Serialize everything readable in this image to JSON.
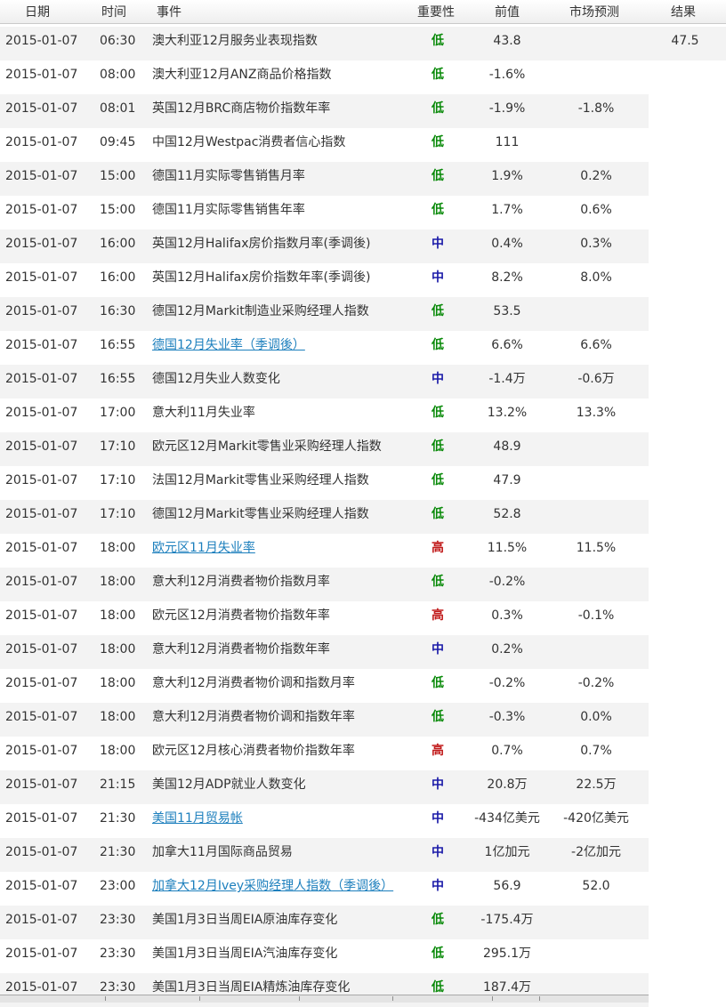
{
  "header": {
    "date": "日期",
    "time": "时间",
    "event": "事件",
    "importance": "重要性",
    "previous": "前值",
    "forecast": "市场预测",
    "result": "结果"
  },
  "colors": {
    "low": "#0a8a0a",
    "medium": "#1a1aa8",
    "high": "#c01818",
    "link": "#1c7fbd"
  },
  "rows": [
    {
      "date": "2015-01-07",
      "time": "06:30",
      "event": "澳大利亚12月服务业表现指数",
      "link": false,
      "importance": "低",
      "level": "low",
      "previous": "43.8",
      "forecast": "",
      "result": "47.5"
    },
    {
      "date": "2015-01-07",
      "time": "08:00",
      "event": "澳大利亚12月ANZ商品价格指数",
      "link": false,
      "importance": "低",
      "level": "low",
      "previous": "-1.6%",
      "forecast": "",
      "result": ""
    },
    {
      "date": "2015-01-07",
      "time": "08:01",
      "event": "英国12月BRC商店物价指数年率",
      "link": false,
      "importance": "低",
      "level": "low",
      "previous": "-1.9%",
      "forecast": "-1.8%",
      "result": ""
    },
    {
      "date": "2015-01-07",
      "time": "09:45",
      "event": "中国12月Westpac消费者信心指数",
      "link": false,
      "importance": "低",
      "level": "low",
      "previous": "111",
      "forecast": "",
      "result": ""
    },
    {
      "date": "2015-01-07",
      "time": "15:00",
      "event": "德国11月实际零售销售月率",
      "link": false,
      "importance": "低",
      "level": "low",
      "previous": "1.9%",
      "forecast": "0.2%",
      "result": ""
    },
    {
      "date": "2015-01-07",
      "time": "15:00",
      "event": "德国11月实际零售销售年率",
      "link": false,
      "importance": "低",
      "level": "low",
      "previous": "1.7%",
      "forecast": "0.6%",
      "result": ""
    },
    {
      "date": "2015-01-07",
      "time": "16:00",
      "event": "英国12月Halifax房价指数月率(季调後)",
      "link": false,
      "importance": "中",
      "level": "medium",
      "previous": "0.4%",
      "forecast": "0.3%",
      "result": ""
    },
    {
      "date": "2015-01-07",
      "time": "16:00",
      "event": "英国12月Halifax房价指数年率(季调後)",
      "link": false,
      "importance": "中",
      "level": "medium",
      "previous": "8.2%",
      "forecast": "8.0%",
      "result": ""
    },
    {
      "date": "2015-01-07",
      "time": "16:30",
      "event": "德国12月Markit制造业采购经理人指数",
      "link": false,
      "importance": "低",
      "level": "low",
      "previous": "53.5",
      "forecast": "",
      "result": ""
    },
    {
      "date": "2015-01-07",
      "time": "16:55",
      "event": "德国12月失业率（季调後）",
      "link": true,
      "importance": "低",
      "level": "low",
      "previous": "6.6%",
      "forecast": "6.6%",
      "result": ""
    },
    {
      "date": "2015-01-07",
      "time": "16:55",
      "event": "德国12月失业人数变化",
      "link": false,
      "importance": "中",
      "level": "medium",
      "previous": "-1.4万",
      "forecast": "-0.6万",
      "result": ""
    },
    {
      "date": "2015-01-07",
      "time": "17:00",
      "event": "意大利11月失业率",
      "link": false,
      "importance": "低",
      "level": "low",
      "previous": "13.2%",
      "forecast": "13.3%",
      "result": ""
    },
    {
      "date": "2015-01-07",
      "time": "17:10",
      "event": "欧元区12月Markit零售业采购经理人指数",
      "link": false,
      "importance": "低",
      "level": "low",
      "previous": "48.9",
      "forecast": "",
      "result": ""
    },
    {
      "date": "2015-01-07",
      "time": "17:10",
      "event": "法国12月Markit零售业采购经理人指数",
      "link": false,
      "importance": "低",
      "level": "low",
      "previous": "47.9",
      "forecast": "",
      "result": ""
    },
    {
      "date": "2015-01-07",
      "time": "17:10",
      "event": "德国12月Markit零售业采购经理人指数",
      "link": false,
      "importance": "低",
      "level": "low",
      "previous": "52.8",
      "forecast": "",
      "result": ""
    },
    {
      "date": "2015-01-07",
      "time": "18:00",
      "event": "欧元区11月失业率",
      "link": true,
      "importance": "高",
      "level": "high",
      "previous": "11.5%",
      "forecast": "11.5%",
      "result": ""
    },
    {
      "date": "2015-01-07",
      "time": "18:00",
      "event": "意大利12月消费者物价指数月率",
      "link": false,
      "importance": "低",
      "level": "low",
      "previous": "-0.2%",
      "forecast": "",
      "result": ""
    },
    {
      "date": "2015-01-07",
      "time": "18:00",
      "event": "欧元区12月消费者物价指数年率",
      "link": false,
      "importance": "高",
      "level": "high",
      "previous": "0.3%",
      "forecast": "-0.1%",
      "result": ""
    },
    {
      "date": "2015-01-07",
      "time": "18:00",
      "event": "意大利12月消费者物价指数年率",
      "link": false,
      "importance": "中",
      "level": "medium",
      "previous": "0.2%",
      "forecast": "",
      "result": ""
    },
    {
      "date": "2015-01-07",
      "time": "18:00",
      "event": "意大利12月消费者物价调和指数月率",
      "link": false,
      "importance": "低",
      "level": "low",
      "previous": "-0.2%",
      "forecast": "-0.2%",
      "result": ""
    },
    {
      "date": "2015-01-07",
      "time": "18:00",
      "event": "意大利12月消费者物价调和指数年率",
      "link": false,
      "importance": "低",
      "level": "low",
      "previous": "-0.3%",
      "forecast": "0.0%",
      "result": ""
    },
    {
      "date": "2015-01-07",
      "time": "18:00",
      "event": "欧元区12月核心消费者物价指数年率",
      "link": false,
      "importance": "高",
      "level": "high",
      "previous": "0.7%",
      "forecast": "0.7%",
      "result": ""
    },
    {
      "date": "2015-01-07",
      "time": "21:15",
      "event": "美国12月ADP就业人数变化",
      "link": false,
      "importance": "中",
      "level": "medium",
      "previous": "20.8万",
      "forecast": "22.5万",
      "result": ""
    },
    {
      "date": "2015-01-07",
      "time": "21:30",
      "event": "美国11月贸易帐",
      "link": true,
      "importance": "中",
      "level": "medium",
      "previous": "-434亿美元",
      "forecast": "-420亿美元",
      "result": ""
    },
    {
      "date": "2015-01-07",
      "time": "21:30",
      "event": "加拿大11月国际商品贸易",
      "link": false,
      "importance": "中",
      "level": "medium",
      "previous": "1亿加元",
      "forecast": "-2亿加元",
      "result": ""
    },
    {
      "date": "2015-01-07",
      "time": "23:00",
      "event": "加拿大12月Ivey采购经理人指数（季调後）",
      "link": true,
      "importance": "中",
      "level": "medium",
      "previous": "56.9",
      "forecast": "52.0",
      "result": ""
    },
    {
      "date": "2015-01-07",
      "time": "23:30",
      "event": "美国1月3日当周EIA原油库存变化",
      "link": false,
      "importance": "低",
      "level": "low",
      "previous": "-175.4万",
      "forecast": "",
      "result": ""
    },
    {
      "date": "2015-01-07",
      "time": "23:30",
      "event": "美国1月3日当周EIA汽油库存变化",
      "link": false,
      "importance": "低",
      "level": "low",
      "previous": "295.1万",
      "forecast": "",
      "result": ""
    },
    {
      "date": "2015-01-07",
      "time": "23:30",
      "event": "美国1月3日当周EIA精炼油库存变化",
      "link": false,
      "importance": "低",
      "level": "low",
      "previous": "187.4万",
      "forecast": "",
      "result": ""
    }
  ]
}
